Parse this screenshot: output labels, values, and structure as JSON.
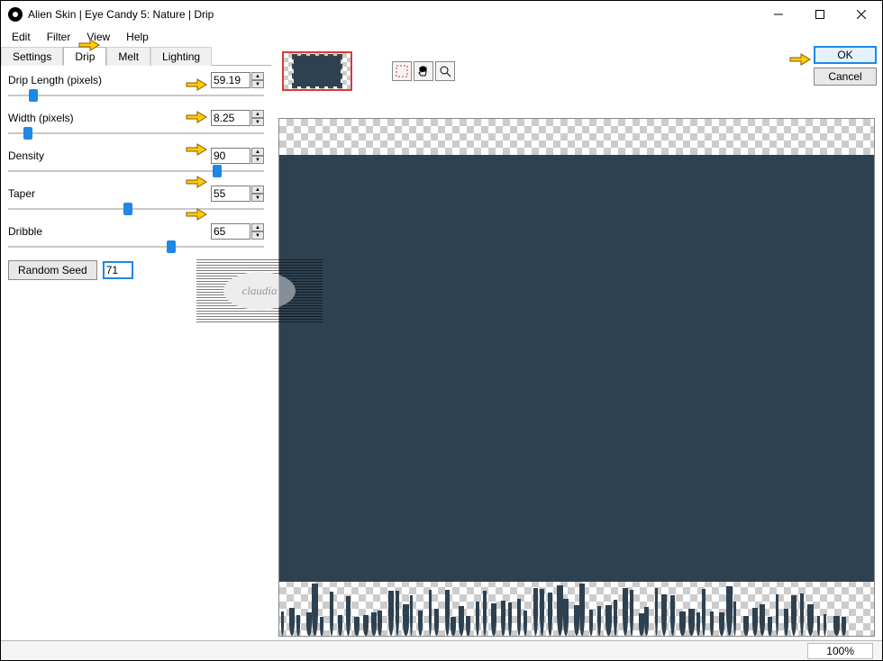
{
  "window": {
    "title": "Alien Skin | Eye Candy 5: Nature | Drip"
  },
  "menu": {
    "edit": "Edit",
    "filter": "Filter",
    "view": "View",
    "help": "Help"
  },
  "tabs": {
    "settings": "Settings",
    "drip": "Drip",
    "melt": "Melt",
    "lighting": "Lighting"
  },
  "params": {
    "drip_length": {
      "label": "Drip Length (pixels)",
      "value": "59.19",
      "pos": 8
    },
    "width": {
      "label": "Width (pixels)",
      "value": "8.25",
      "pos": 6
    },
    "density": {
      "label": "Density",
      "value": "90",
      "pos": 80
    },
    "taper": {
      "label": "Taper",
      "value": "55",
      "pos": 45
    },
    "dribble": {
      "label": "Dribble",
      "value": "65",
      "pos": 62
    }
  },
  "random": {
    "button": "Random Seed",
    "value": "71"
  },
  "actions": {
    "ok": "OK",
    "cancel": "Cancel"
  },
  "status": {
    "zoom": "100%"
  },
  "watermark": "claudia"
}
